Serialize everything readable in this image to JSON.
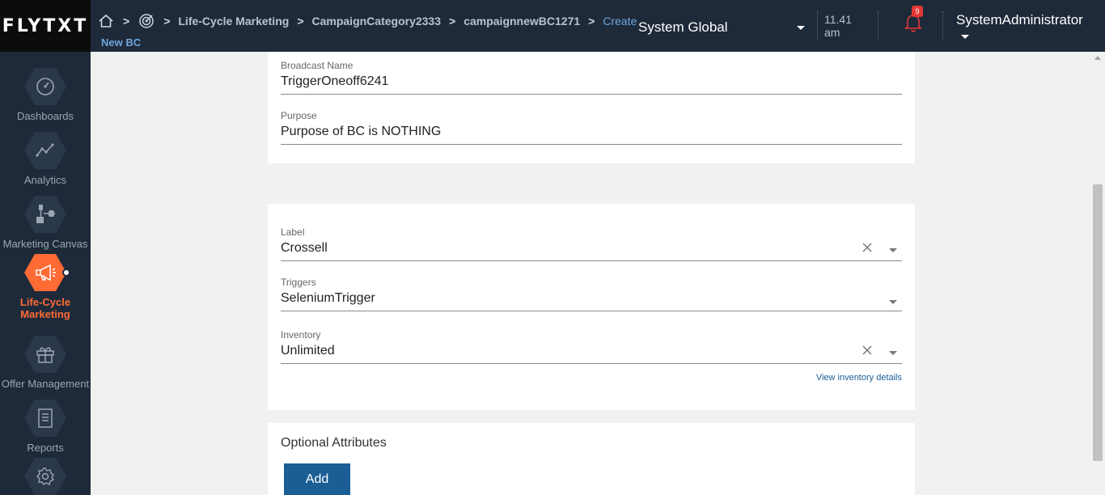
{
  "brand": {
    "logo_text": "FLYTXT"
  },
  "breadcrumb": {
    "items": [
      "Life-Cycle Marketing",
      "CampaignCategory2333",
      "campaignnewBC1271",
      "Create"
    ],
    "sub": "New BC"
  },
  "header": {
    "org_select": "System Global",
    "time": {
      "value": "11.41",
      "period": "am"
    },
    "notifications_count": "9",
    "user": "SystemAdministrator"
  },
  "sidebar": {
    "items": [
      {
        "label": "Dashboards",
        "icon": "dashboard-icon"
      },
      {
        "label": "Analytics",
        "icon": "analytics-icon"
      },
      {
        "label": "Marketing Canvas",
        "icon": "canvas-icon"
      },
      {
        "label": "Life-Cycle Marketing",
        "icon": "megaphone-icon",
        "active": true
      },
      {
        "label": "Offer Management",
        "icon": "gift-icon"
      },
      {
        "label": "Reports",
        "icon": "report-icon"
      },
      {
        "label": "",
        "icon": "settings-icon"
      }
    ]
  },
  "form": {
    "broadcast_name": {
      "label": "Broadcast Name",
      "value": "TriggerOneoff6241"
    },
    "purpose": {
      "label": "Purpose",
      "value": "Purpose of BC is NOTHING"
    },
    "label": {
      "label": "Label",
      "value": "Crossell"
    },
    "triggers": {
      "label": "Triggers",
      "value": "SeleniumTrigger"
    },
    "inventory": {
      "label": "Inventory",
      "value": "Unlimited"
    },
    "inventory_link": "View inventory details"
  },
  "optional": {
    "title": "Optional Attributes",
    "add_label": "Add"
  },
  "colors": {
    "accent": "#ff6b35",
    "primary": "#1b5e96",
    "nav_bg": "#1e2a3a"
  }
}
